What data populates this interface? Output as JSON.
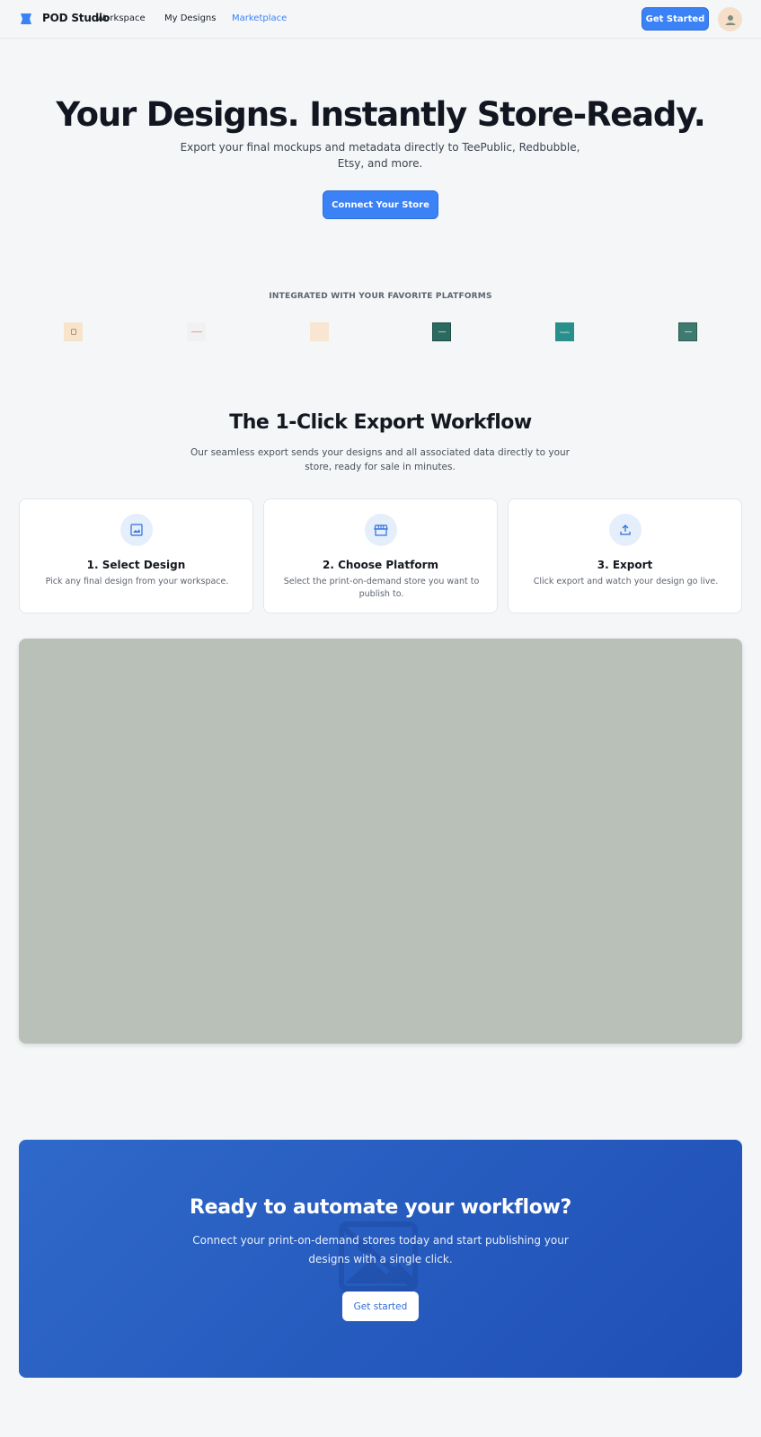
{
  "nav": {
    "brand": "POD Studio",
    "links": [
      "Workspace",
      "My Designs",
      "Marketplace"
    ],
    "active_link": "Marketplace",
    "cta": "Get Started",
    "accent_color": "#3b82f6"
  },
  "hero": {
    "title": "Your Designs. Instantly Store-Ready.",
    "subtitle": "Export your final mockups and metadata directly to TeePublic, Redbubble, Etsy, and more.",
    "button": "Connect Your Store"
  },
  "platforms": {
    "heading": "INTEGRATED WITH YOUR FAVORITE PLATFORMS",
    "logos": [
      {
        "icon": "platform-logo-1",
        "color": "#f7e4cb"
      },
      {
        "icon": "platform-logo-2",
        "color": "#f2f1f2"
      },
      {
        "icon": "platform-logo-3",
        "color": "#f8e6d3"
      },
      {
        "icon": "platform-logo-4",
        "color": "#2c6a5f"
      },
      {
        "icon": "platform-logo-5",
        "color": "#298f8a",
        "label": "shopify"
      },
      {
        "icon": "platform-logo-6",
        "color": "#3e7a70"
      }
    ]
  },
  "workflow": {
    "title": "The 1-Click Export Workflow",
    "subtitle": "Our seamless export sends your designs and all associated data directly to your store, ready for sale in minutes.",
    "steps": [
      {
        "title": "1. Select Design",
        "description": "Pick any final design from your workspace.",
        "icon": "image-icon"
      },
      {
        "title": "2. Choose Platform",
        "description": "Select the print-on-demand store you want to publish to.",
        "icon": "storefront-icon"
      },
      {
        "title": "3. Export",
        "description": "Click export and watch your design go live.",
        "icon": "upload-icon"
      }
    ]
  },
  "cta": {
    "title": "Ready to automate your workflow?",
    "subtitle": "Connect your print-on-demand stores today and start publishing your designs with a single click.",
    "button": "Get started"
  }
}
